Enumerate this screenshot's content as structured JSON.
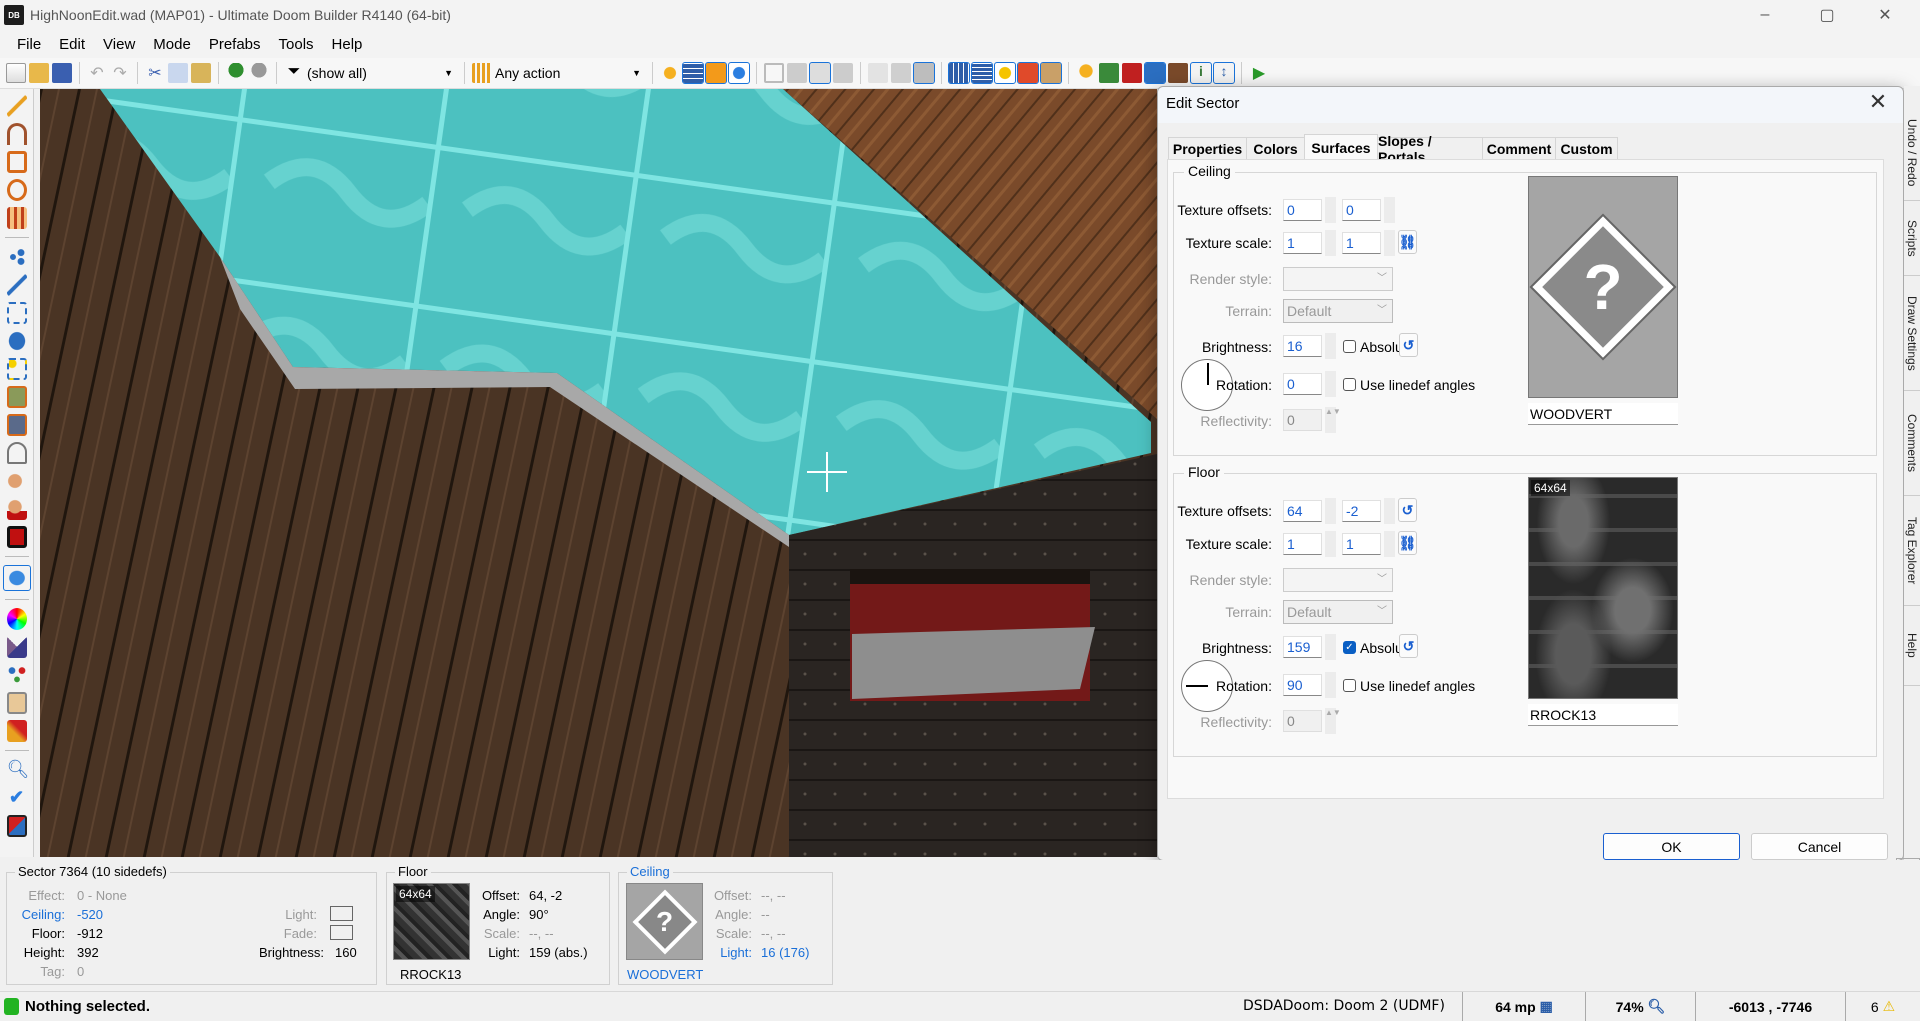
{
  "window": {
    "title": "HighNoonEdit.wad (MAP01) - Ultimate Doom Builder R4140 (64-bit)",
    "app_icon_text": "DB",
    "minimize": "–",
    "maximize": "▢",
    "close": "✕"
  },
  "menu": [
    "File",
    "Edit",
    "View",
    "Mode",
    "Prefabs",
    "Tools",
    "Help"
  ],
  "toolbar": {
    "filter_value": "(show all)",
    "action_value": "Any action"
  },
  "left_tools": [
    "draw-lines-icon",
    "draw-curve-icon",
    "draw-rectangle-icon",
    "draw-ellipse-icon",
    "draw-grid-icon",
    "vertices-mode-icon",
    "linedefs-mode-icon",
    "sectors-mode-icon",
    "things-mode-icon",
    "make-sector-icon",
    "floor-texture-icon",
    "ceiling-texture-icon",
    "gauge-icon",
    "sound-propagation-icon",
    "sound-environment-icon",
    "script-icon",
    "visual-mode-icon",
    "color-picker-icon",
    "terrain-icon",
    "node-builder-icon",
    "tag-range-icon",
    "bridge-icon",
    "find-icon",
    "check-icon",
    "test-map-icon"
  ],
  "dialog": {
    "title": "Edit Sector",
    "close": "✕",
    "tabs": [
      "Properties",
      "Colors",
      "Surfaces",
      "Slopes / Portals",
      "Comment",
      "Custom"
    ],
    "active_tab": "Surfaces",
    "labels": {
      "texture_offsets": "Texture offsets:",
      "texture_scale": "Texture scale:",
      "render_style": "Render style:",
      "terrain": "Terrain:",
      "brightness": "Brightness:",
      "rotation": "Rotation:",
      "reflectivity": "Reflectivity:",
      "absolute": "Absolute",
      "use_linedef_angles": "Use linedef angles"
    },
    "ceiling": {
      "title": "Ceiling",
      "offset_x": "0",
      "offset_y": "0",
      "scale_x": "1",
      "scale_y": "1",
      "render_style": "",
      "terrain": "Default",
      "brightness": "16",
      "absolute": false,
      "rotation": "0",
      "use_linedef_angles": false,
      "reflectivity": "0",
      "texture": "WOODVERT"
    },
    "floor": {
      "title": "Floor",
      "offset_x": "64",
      "offset_y": "-2",
      "scale_x": "1",
      "scale_y": "1",
      "render_style": "",
      "terrain": "Default",
      "brightness": "159",
      "absolute": true,
      "rotation": "90",
      "use_linedef_angles": false,
      "reflectivity": "0",
      "texture": "RROCK13",
      "texture_size": "64x64"
    },
    "ok": "OK",
    "cancel": "Cancel"
  },
  "side_tabs": [
    "Undo / Redo",
    "Scripts",
    "Draw Settings",
    "Comments",
    "Tag Explorer",
    "Help"
  ],
  "info": {
    "sector": {
      "title": "Sector 7364 (10 sidedefs)",
      "effect_label": "Effect:",
      "effect": "0 - None",
      "ceiling_label": "Ceiling:",
      "ceiling": "-520",
      "floor_label": "Floor:",
      "floor": "-912",
      "height_label": "Height:",
      "height": "392",
      "tag_label": "Tag:",
      "tag": "0",
      "light_label": "Light:",
      "fade_label": "Fade:",
      "brightness_label": "Brightness:",
      "brightness": "160"
    },
    "floor": {
      "title": "Floor",
      "size": "64x64",
      "texture": "RROCK13",
      "offset_label": "Offset:",
      "offset": "64, -2",
      "angle_label": "Angle:",
      "angle": "90°",
      "scale_label": "Scale:",
      "scale": "--, --",
      "light_label": "Light:",
      "light": "159 (abs.)"
    },
    "ceiling": {
      "title": "Ceiling",
      "texture": "WOODVERT",
      "offset_label": "Offset:",
      "offset": "--, --",
      "angle_label": "Angle:",
      "angle": "--",
      "scale_label": "Scale:",
      "scale": "--, --",
      "light_label": "Light:",
      "light": "16 (176)"
    }
  },
  "status": {
    "message": "Nothing selected.",
    "game": "DSDADoom: Doom 2 (UDMF)",
    "grid": "64 mp",
    "zoom": "74%",
    "coords": "-6013 , -7746",
    "warnings": "6"
  },
  "colors": {
    "accent": "#1a6fd8",
    "ceiling_surface": "#4fc6c4",
    "status_ok": "#22b322"
  }
}
